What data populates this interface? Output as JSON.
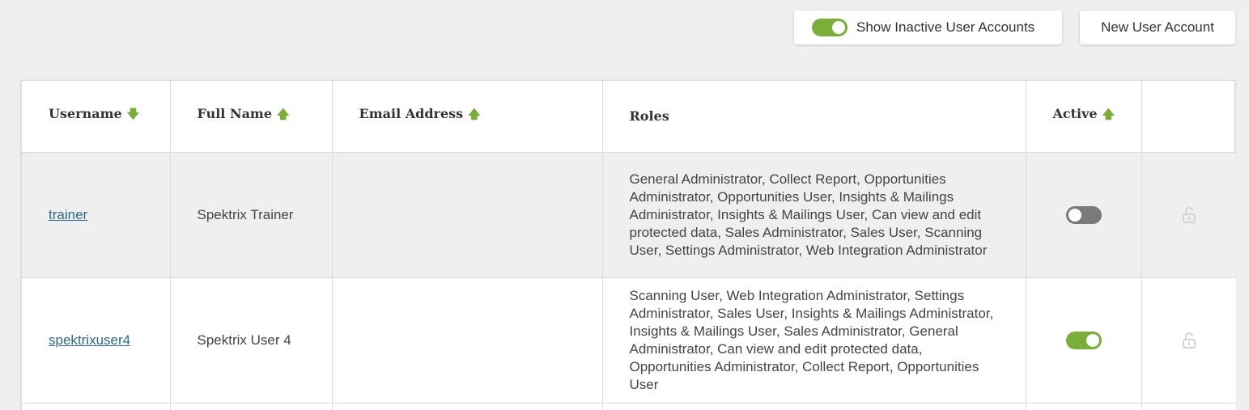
{
  "toolbar": {
    "show_inactive_label": "Show Inactive User Accounts",
    "show_inactive_on": true,
    "new_user_label": "New User Account"
  },
  "table": {
    "headers": {
      "username": "Username",
      "full_name": "Full Name",
      "email": "Email Address",
      "roles": "Roles",
      "active": "Active"
    },
    "rows": [
      {
        "username": "trainer",
        "full_name": "Spektrix Trainer",
        "email": "",
        "roles": "General Administrator, Collect Report, Opportunities Administrator, Opportunities User, Insights & Mailings Administrator, Insights & Mailings User, Can view and edit protected data, Sales Administrator, Sales User, Scanning User, Settings Administrator, Web Integration Administrator",
        "active": false
      },
      {
        "username": "spektrixuser4",
        "full_name": "Spektrix User 4",
        "email": "",
        "roles": "Scanning User, Web Integration Administrator, Settings Administrator, Sales User, Insights & Mailings Administrator, Insights & Mailings User, Sales Administrator, General Administrator, Can view and edit protected data, Opportunities Administrator, Collect Report, Opportunities User",
        "active": true
      }
    ]
  },
  "colors": {
    "accent_green": "#7aad3a",
    "toggle_off": "#7a7a7a",
    "link": "#2c6a8a"
  }
}
